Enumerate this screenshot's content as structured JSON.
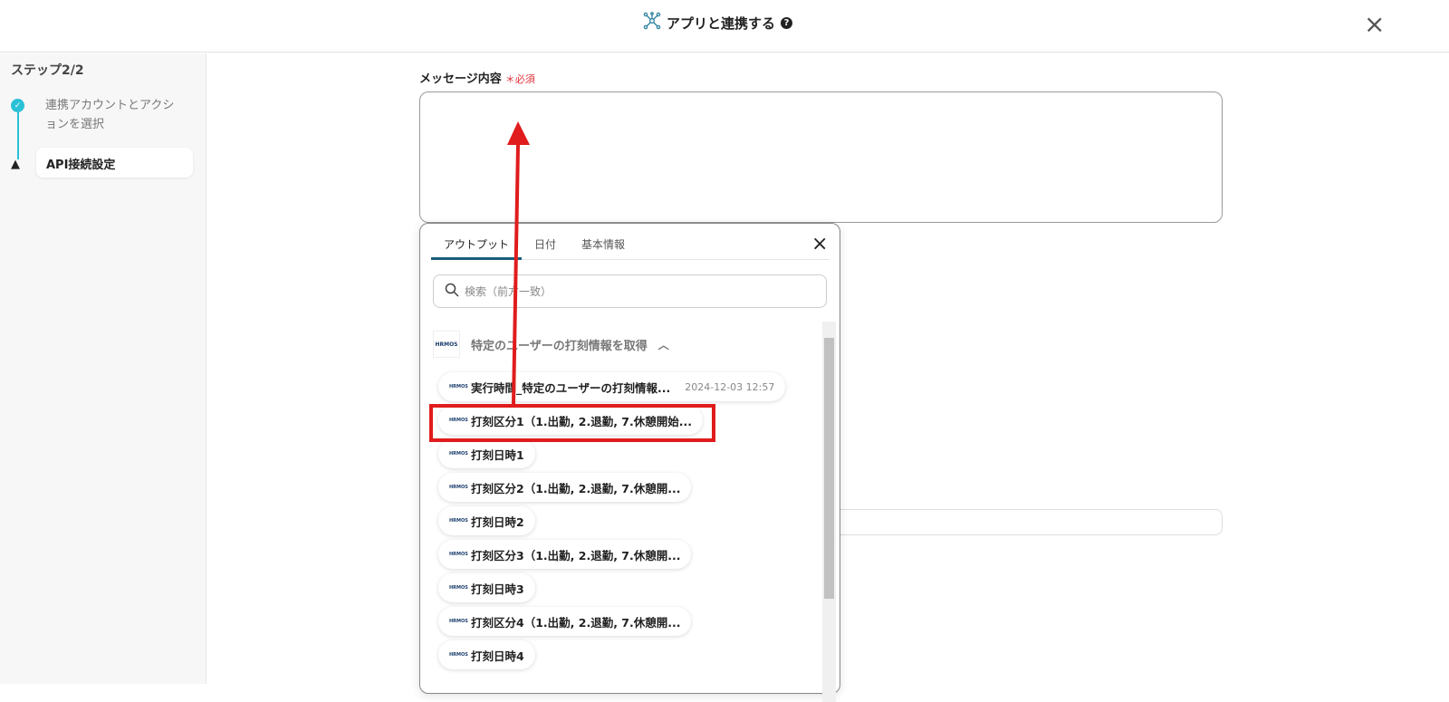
{
  "header": {
    "title": "アプリと連携する",
    "help": "?",
    "close": "×"
  },
  "sidebar": {
    "step": "ステップ2/2",
    "steps": [
      {
        "label": "連携アカウントとアクションを選択",
        "status": "done"
      },
      {
        "label": "API接続設定",
        "status": "warning"
      }
    ]
  },
  "form": {
    "label": "メッセージ内容",
    "required": "＊必須",
    "value": ""
  },
  "popup": {
    "tabs": [
      "アウトプット",
      "日付",
      "基本情報"
    ],
    "close": "×",
    "search_placeholder": "検索（前方一致）",
    "group": {
      "logo": "HRMOS",
      "title": "特定のユーザーの打刻情報を取得",
      "chevron": "^"
    },
    "items": [
      {
        "label": "実行時間_特定のユーザーの打刻情報...",
        "value": "2024-12-03 12:57"
      },
      {
        "label": "打刻区分1（1.出勤, 2.退勤, 7.休憩開始..."
      },
      {
        "label": "打刻日時1"
      },
      {
        "label": "打刻区分2（1.出勤, 2.退勤, 7.休憩開..."
      },
      {
        "label": "打刻日時2"
      },
      {
        "label": "打刻区分3（1.出勤, 2.退勤, 7.休憩開..."
      },
      {
        "label": "打刻日時3"
      },
      {
        "label": "打刻区分4（1.出勤, 2.退勤, 7.休憩開..."
      },
      {
        "label": "打刻日時4"
      }
    ]
  }
}
